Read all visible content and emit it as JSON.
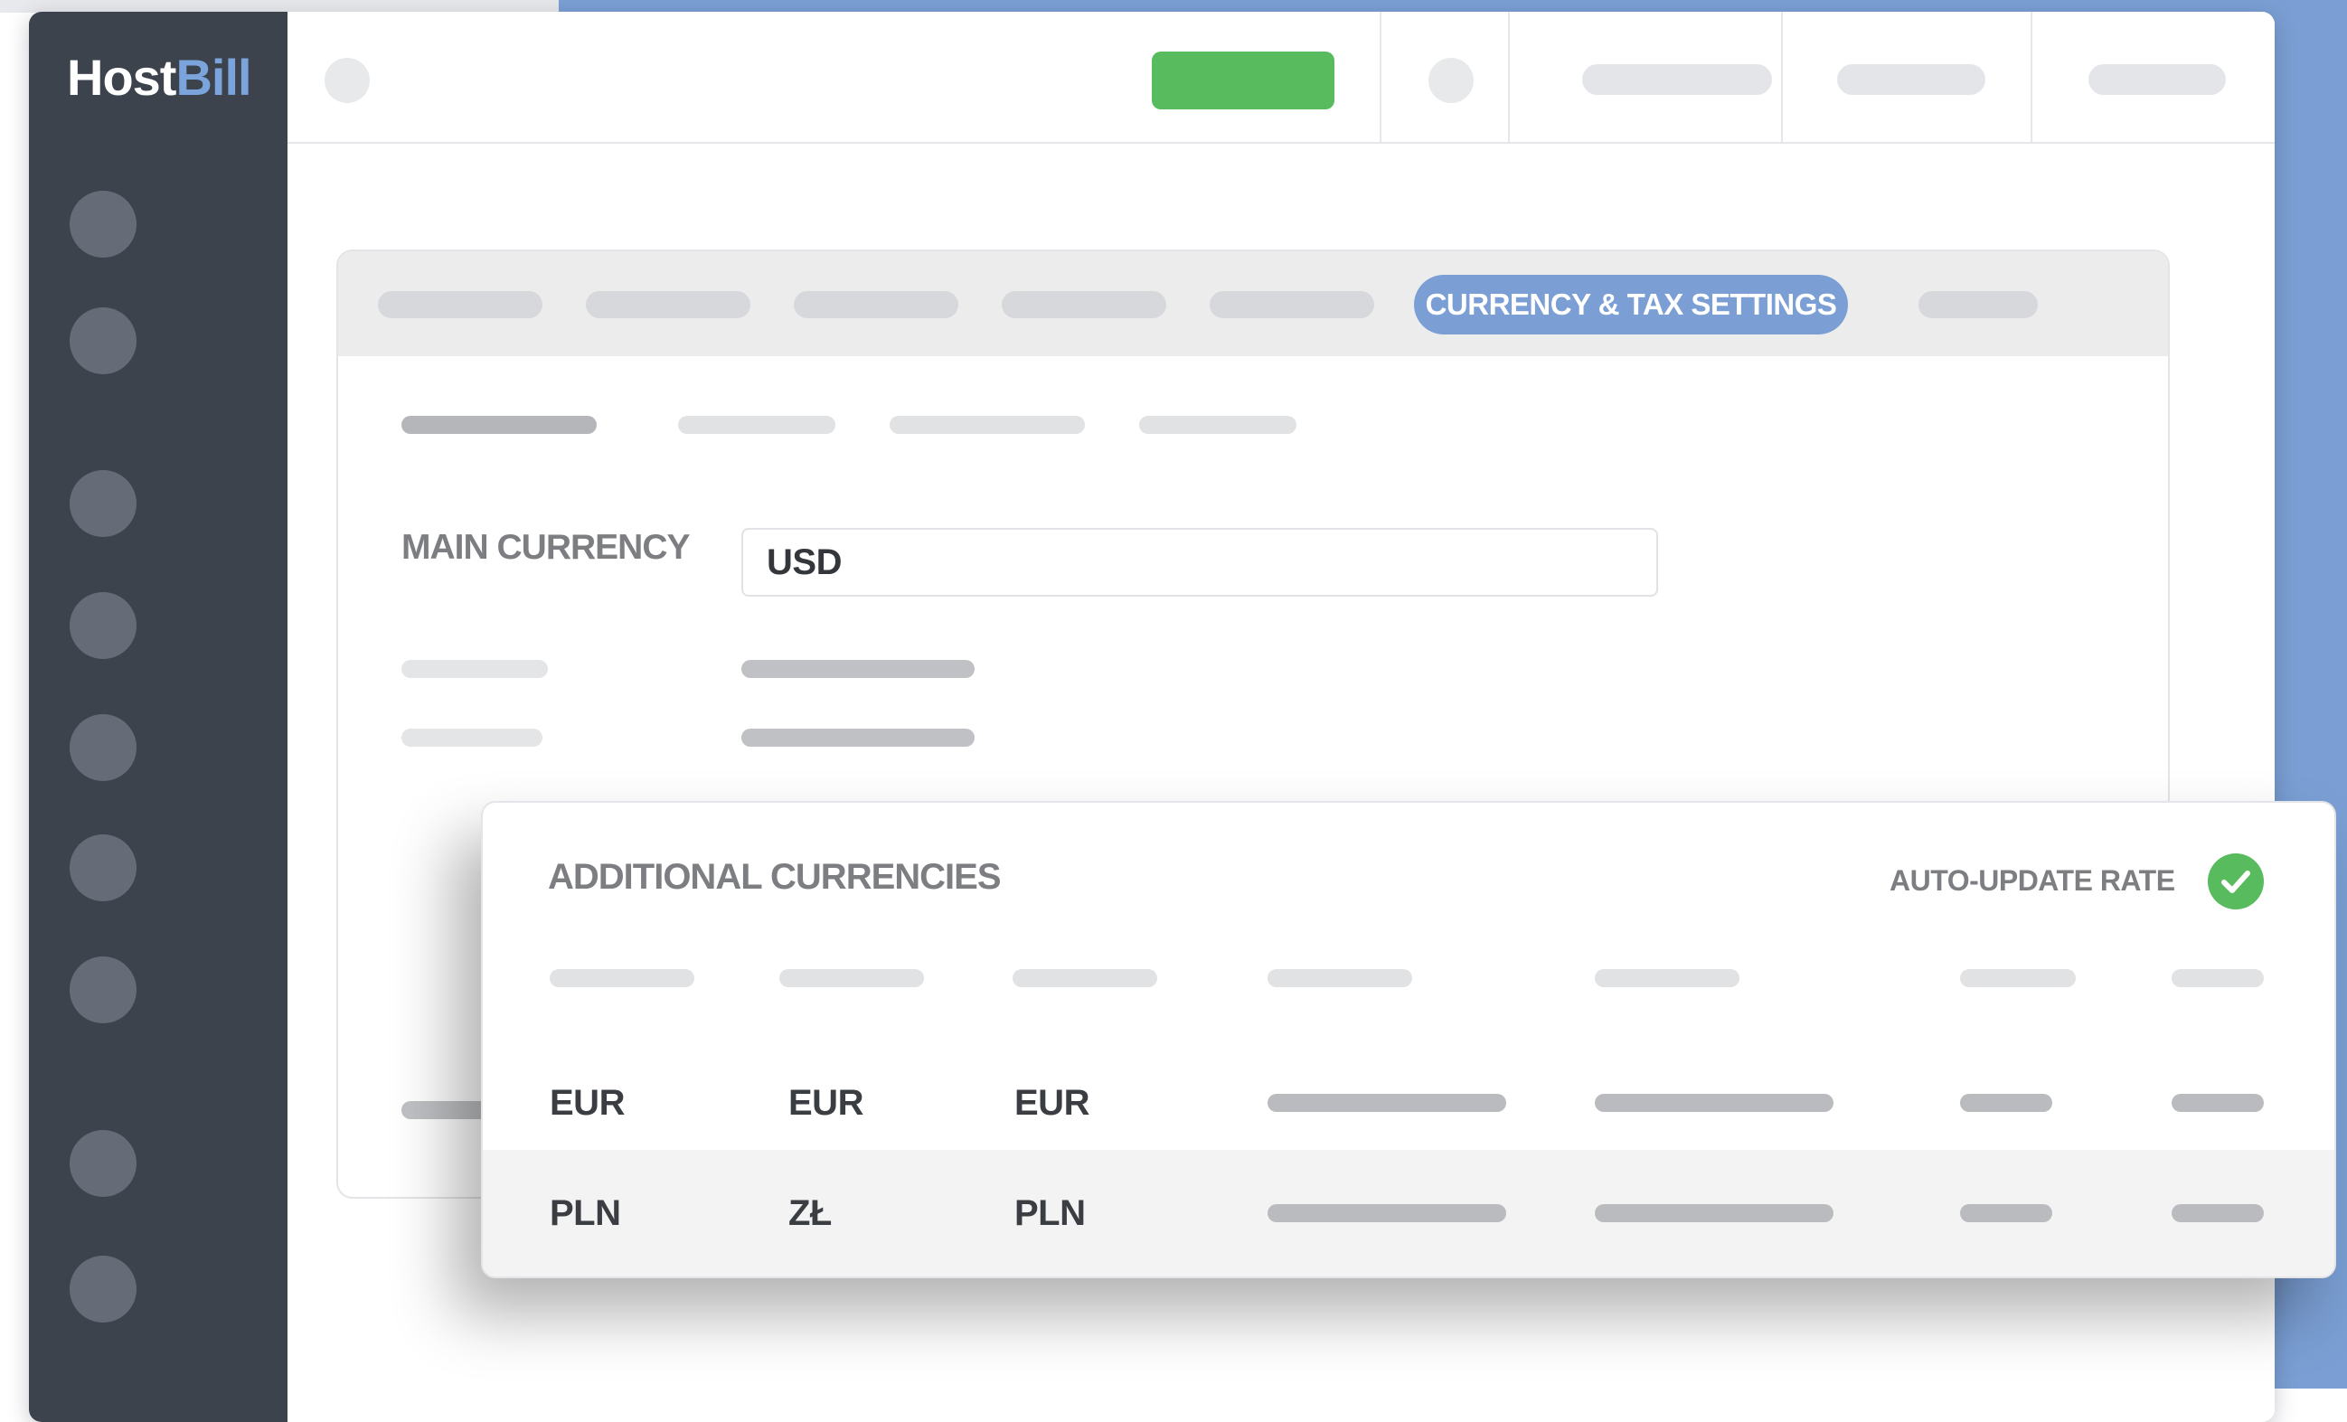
{
  "app": {
    "logo_host": "Host",
    "logo_bill": "Bill"
  },
  "colors": {
    "accent": "#7b9fd4",
    "success": "#58bb5d",
    "sidebar": "#3d434d"
  },
  "tabs": {
    "active_label": "CURRENCY & TAX SETTINGS"
  },
  "form": {
    "main_currency_label": "MAIN CURRENCY",
    "main_currency_value": "USD"
  },
  "additional": {
    "title": "ADDITIONAL CURRENCIES",
    "auto_update_label": "AUTO-UPDATE RATE",
    "auto_update_enabled": true,
    "rows": [
      {
        "code": "EUR",
        "symbol": "EUR",
        "iso": "EUR"
      },
      {
        "code": "PLN",
        "symbol": "ZŁ",
        "iso": "PLN"
      }
    ]
  },
  "icons": {
    "check": "check-circle-icon"
  }
}
